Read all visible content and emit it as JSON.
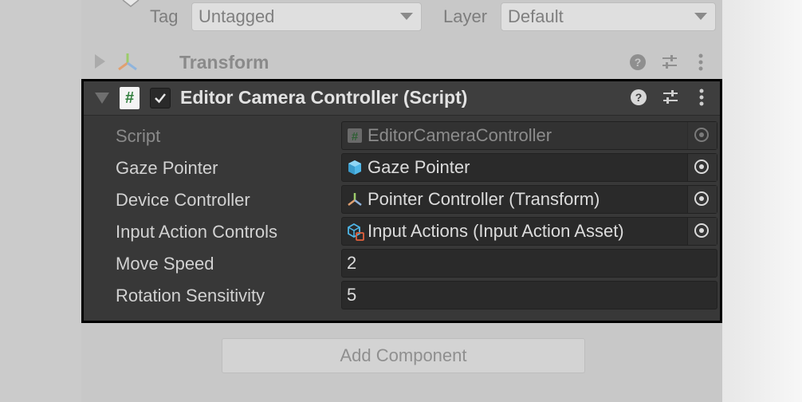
{
  "tag_row": {
    "tag_label": "Tag",
    "tag_value": "Untagged",
    "layer_label": "Layer",
    "layer_value": "Default"
  },
  "transform": {
    "title": "Transform",
    "icons": [
      "transform-axes-icon",
      "help-icon",
      "preset-sliders-icon",
      "more-vert-icon"
    ]
  },
  "component": {
    "title": "Editor Camera Controller (Script)",
    "enabled": true,
    "icons": [
      "script-hash-icon",
      "help-icon",
      "preset-sliders-icon",
      "more-vert-icon"
    ],
    "properties": [
      {
        "label": "Script",
        "value": "EditorCameraController",
        "icon": "script-hash-icon",
        "disabled": true
      },
      {
        "label": "Gaze Pointer",
        "value": "Gaze Pointer",
        "icon": "prefab-cube-icon"
      },
      {
        "label": "Device Controller",
        "value": "Pointer Controller (Transform)",
        "icon": "transform-axes-icon"
      },
      {
        "label": "Input Action Controls",
        "value": "Input Actions (Input Action Asset)",
        "icon": "input-action-asset-icon"
      },
      {
        "label": "Move Speed",
        "value": "2"
      },
      {
        "label": "Rotation Sensitivity",
        "value": "5"
      }
    ]
  },
  "add_component_label": "Add Component",
  "colors": {
    "inspector_bg": "#c8c8c8",
    "component_bg": "#383838",
    "field_bg": "#2a2a2a",
    "highlight_border": "#000000",
    "script_icon_green": "#2f7d3b"
  }
}
